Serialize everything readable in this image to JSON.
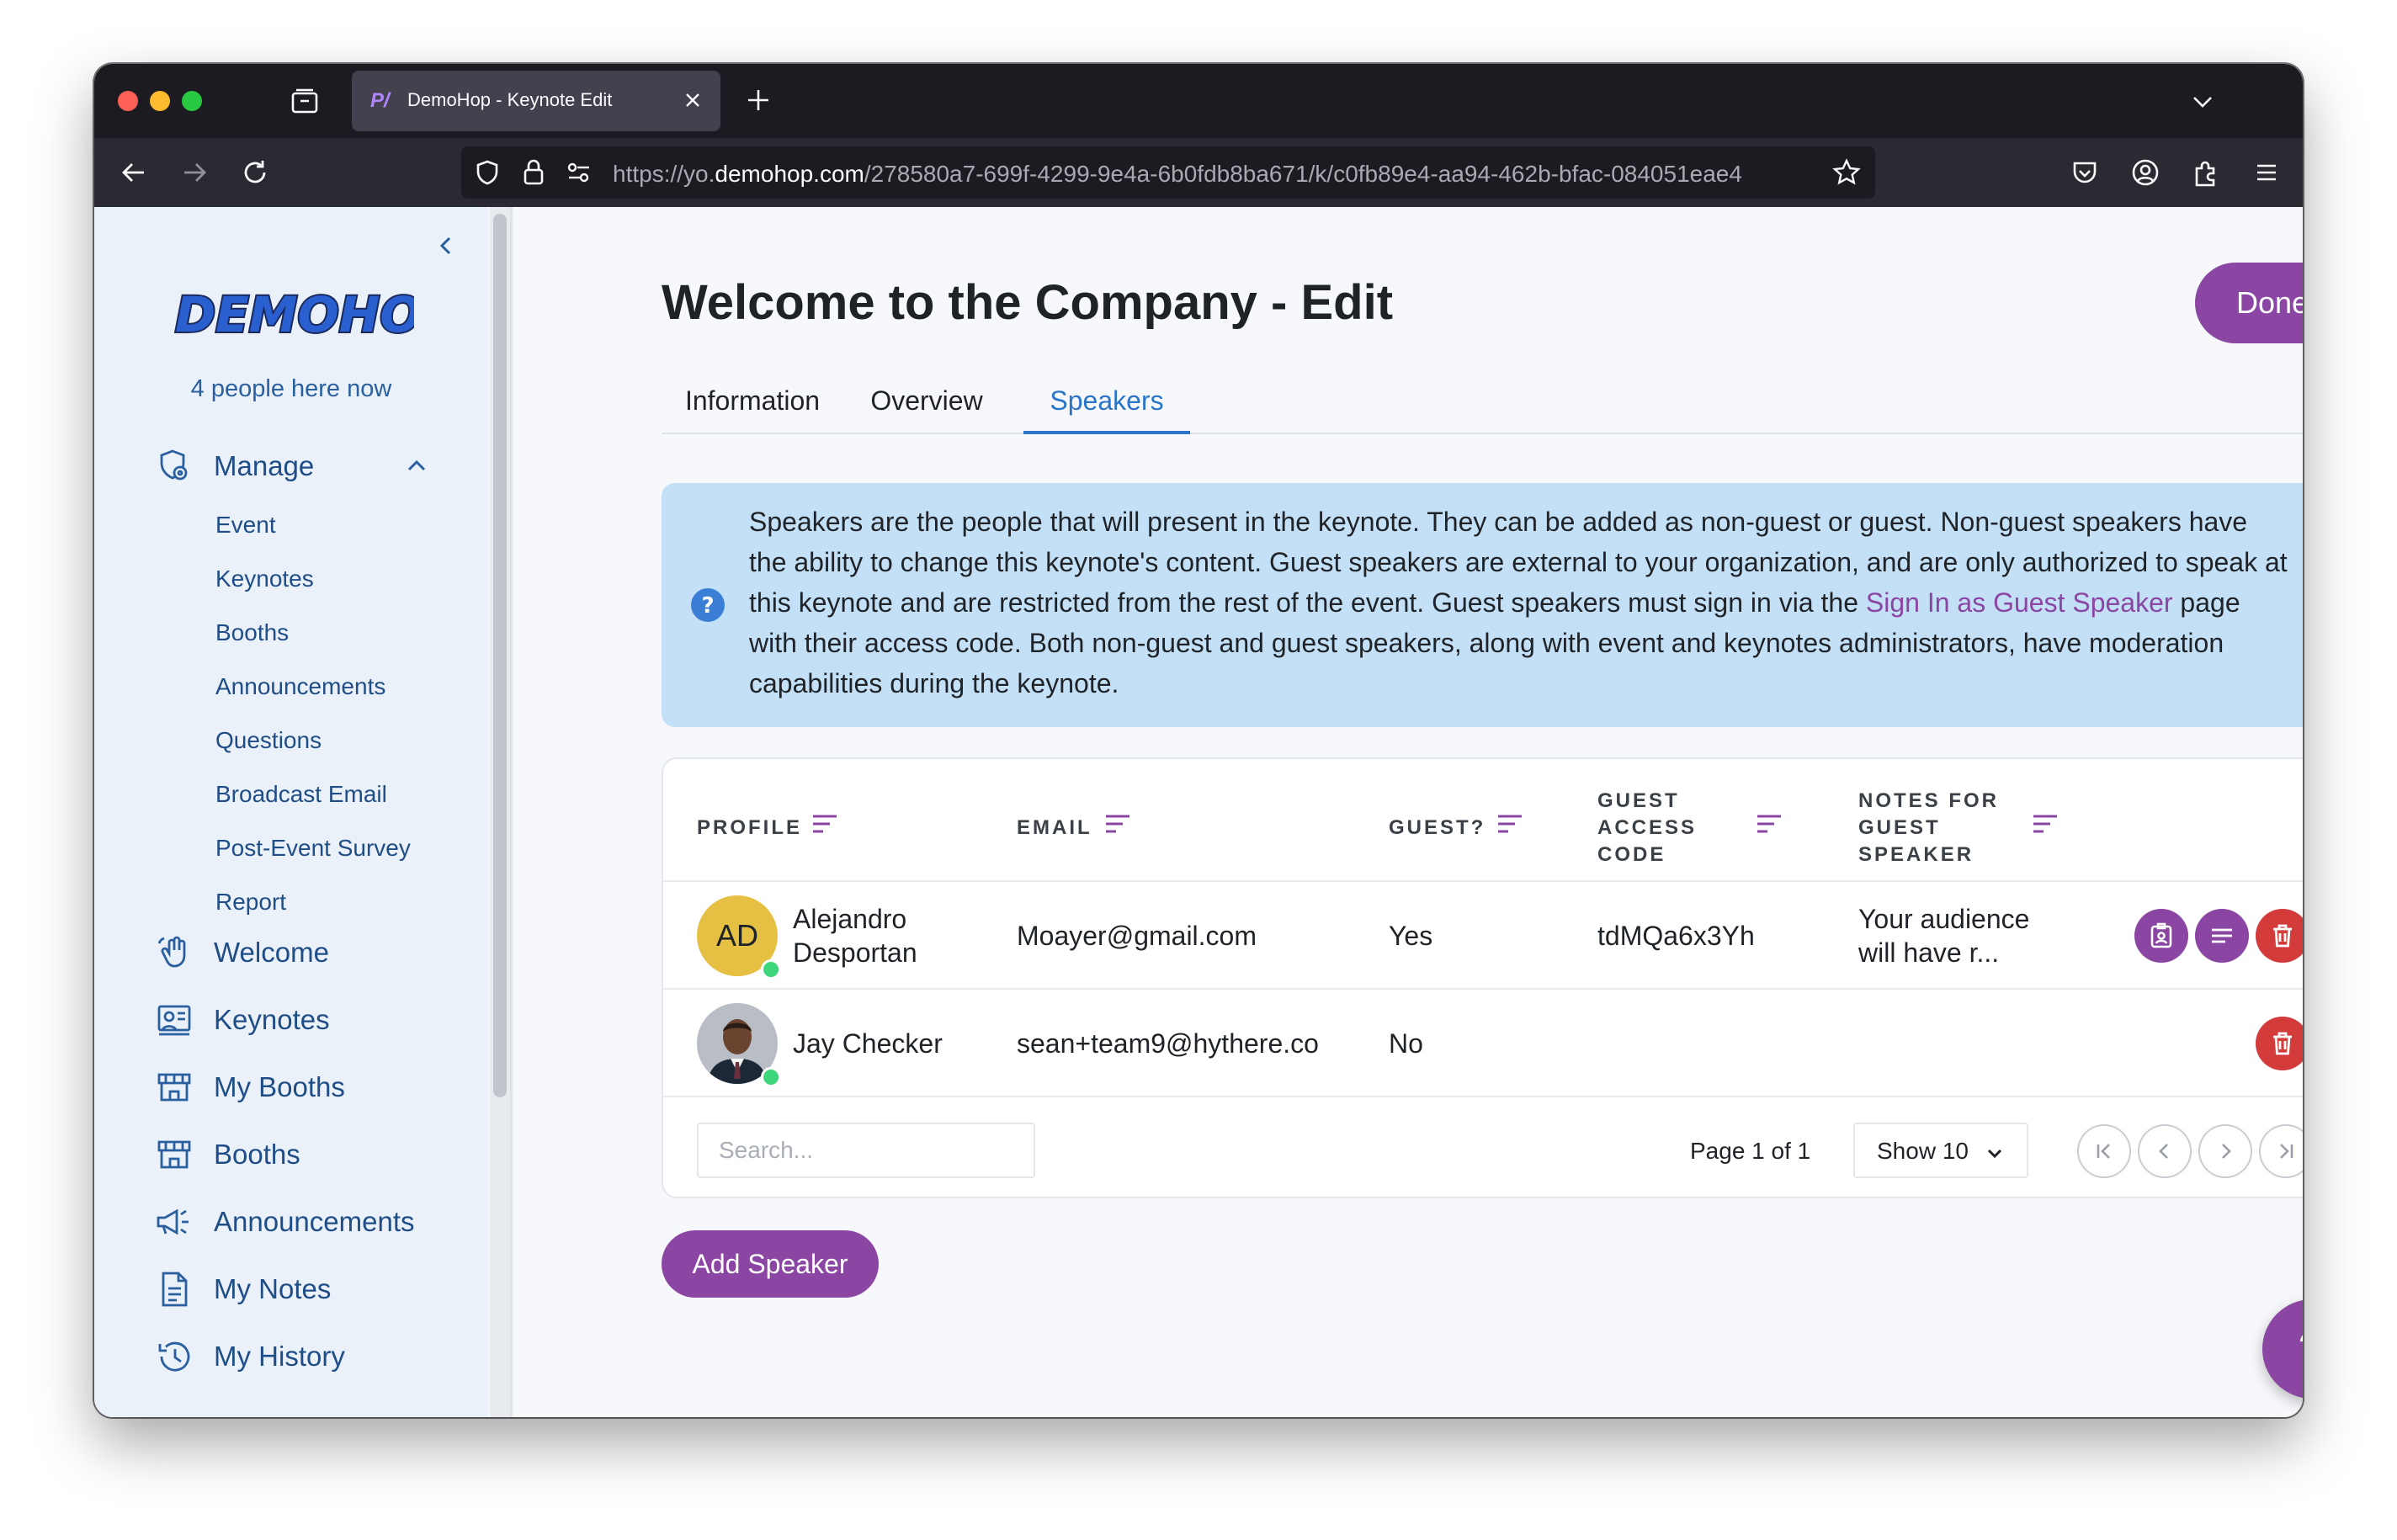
{
  "browser": {
    "tab_title": "DemoHop - Keynote Edit",
    "url_prefix": "https://yo.",
    "url_host": "demohop.com",
    "url_path": "/278580a7-699f-4299-9e4a-6b0fdb8ba671/k/c0fb89e4-aa94-462b-bfac-084051eae4"
  },
  "sidebar": {
    "brand": "DEMOHOP",
    "presence": "4 people here now",
    "manage_label": "Manage",
    "manage_items": [
      "Event",
      "Keynotes",
      "Booths",
      "Announcements",
      "Questions",
      "Broadcast Email",
      "Post-Event Survey",
      "Report"
    ],
    "nav_items": [
      "Welcome",
      "Keynotes",
      "My Booths",
      "Booths",
      "Announcements",
      "My Notes",
      "My History"
    ]
  },
  "page": {
    "title": "Welcome to the Company - Edit",
    "done_label": "Done",
    "tabs": [
      "Information",
      "Overview",
      "Speakers"
    ],
    "active_tab": "Speakers"
  },
  "info": {
    "text_before_link": "Speakers are the people that will present in the keynote. They can be added as non-guest or guest. Non-guest speakers have the ability to change this keynote's content. Guest speakers are external to your organization, and are only authorized to speak at this keynote and are restricted from the rest of the event. Guest speakers must sign in via the ",
    "link_text": "Sign In as Guest Speaker",
    "text_after_link": " page with their access code. Both non-guest and guest speakers, along with event and keynotes administrators, have moderation capabilities during the keynote."
  },
  "table": {
    "headers": {
      "profile": "PROFILE",
      "email": "EMAIL",
      "guest": "GUEST?",
      "code_l1": "GUEST",
      "code_l2": "ACCESS",
      "code_l3": "CODE",
      "notes_l1": "NOTES FOR",
      "notes_l2": "GUEST",
      "notes_l3": "SPEAKER"
    },
    "rows": [
      {
        "initials": "AD",
        "name_l1": "Alejandro",
        "name_l2": "Desportan",
        "email": "Moayer@gmail.com",
        "guest": "Yes",
        "code": "tdMQa6x3Yh",
        "notes_l1": "Your audience",
        "notes_l2": "will have r..."
      },
      {
        "initials": "",
        "name_l1": "Jay Checker",
        "email": "sean+team9@hythere.co",
        "guest": "No",
        "code": "",
        "notes_l1": ""
      }
    ],
    "search_placeholder": "Search...",
    "page_info": "Page 1 of 1",
    "page_size": "Show 10"
  },
  "add_speaker_label": "Add Speaker",
  "help_label": "?",
  "colors": {
    "accent": "#8b45a3",
    "danger": "#d43c3c",
    "link_blue": "#2a74c9",
    "info_bg": "#c4e0f6"
  }
}
